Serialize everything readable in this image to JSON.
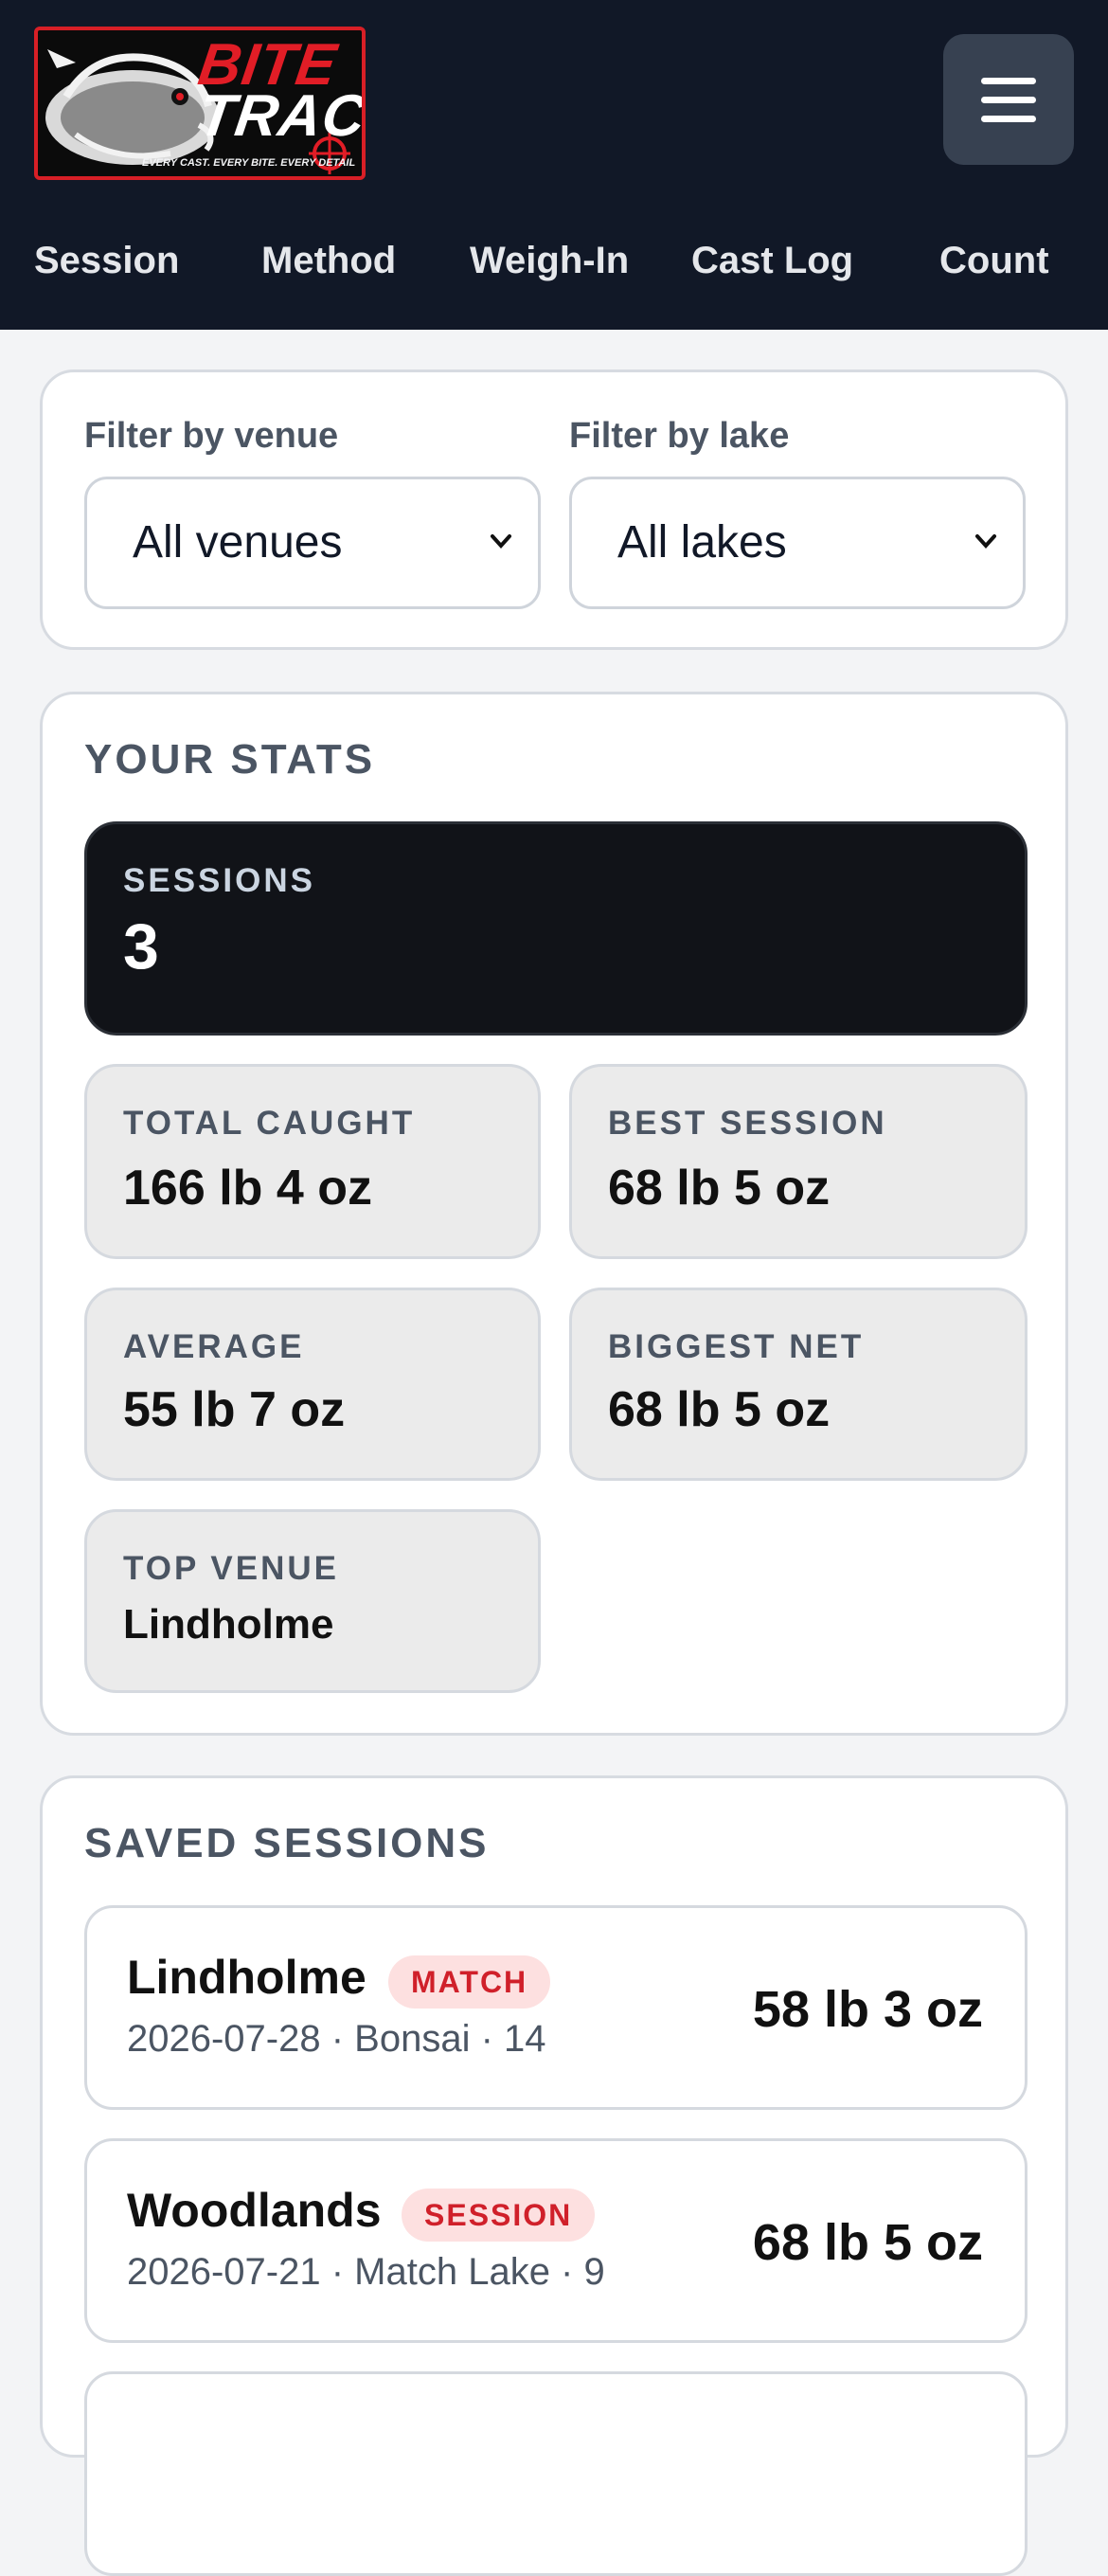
{
  "header": {
    "logo": {
      "line1": "BITE",
      "line2": "TRACK",
      "tagline": "EVERY CAST. EVERY BITE. EVERY DETAIL"
    },
    "menu_icon": "hamburger-menu-icon",
    "nav": [
      "Session",
      "Method",
      "Weigh-In",
      "Cast Log",
      "Count"
    ]
  },
  "filters": {
    "venue_label": "Filter by venue",
    "venue_value": "All venues",
    "lake_label": "Filter by lake",
    "lake_value": "All lakes"
  },
  "stats": {
    "title": "YOUR STATS",
    "sessions_label": "SESSIONS",
    "sessions_value": "3",
    "total_label": "TOTAL CAUGHT",
    "total_value": "166 lb 4 oz",
    "best_label": "BEST SESSION",
    "best_value": "68 lb 5 oz",
    "average_label": "AVERAGE",
    "average_value": "55 lb 7 oz",
    "biggest_label": "BIGGEST NET",
    "biggest_value": "68 lb 5 oz",
    "top_venue_label": "TOP VENUE",
    "top_venue_value": "Lindholme"
  },
  "saved": {
    "title": "SAVED SESSIONS",
    "items": [
      {
        "venue": "Lindholme",
        "badge": "MATCH",
        "meta": "2026-07-28 · Bonsai · 14",
        "weight": "58 lb 3 oz"
      },
      {
        "venue": "Woodlands",
        "badge": "SESSION",
        "meta": "2026-07-21 · Match Lake · 9",
        "weight": "68 lb 5 oz"
      }
    ]
  },
  "colors": {
    "header_bg": "#111827",
    "brand_red": "#e11d26",
    "badge_bg": "#fde0e0",
    "badge_text": "#d0202a"
  }
}
